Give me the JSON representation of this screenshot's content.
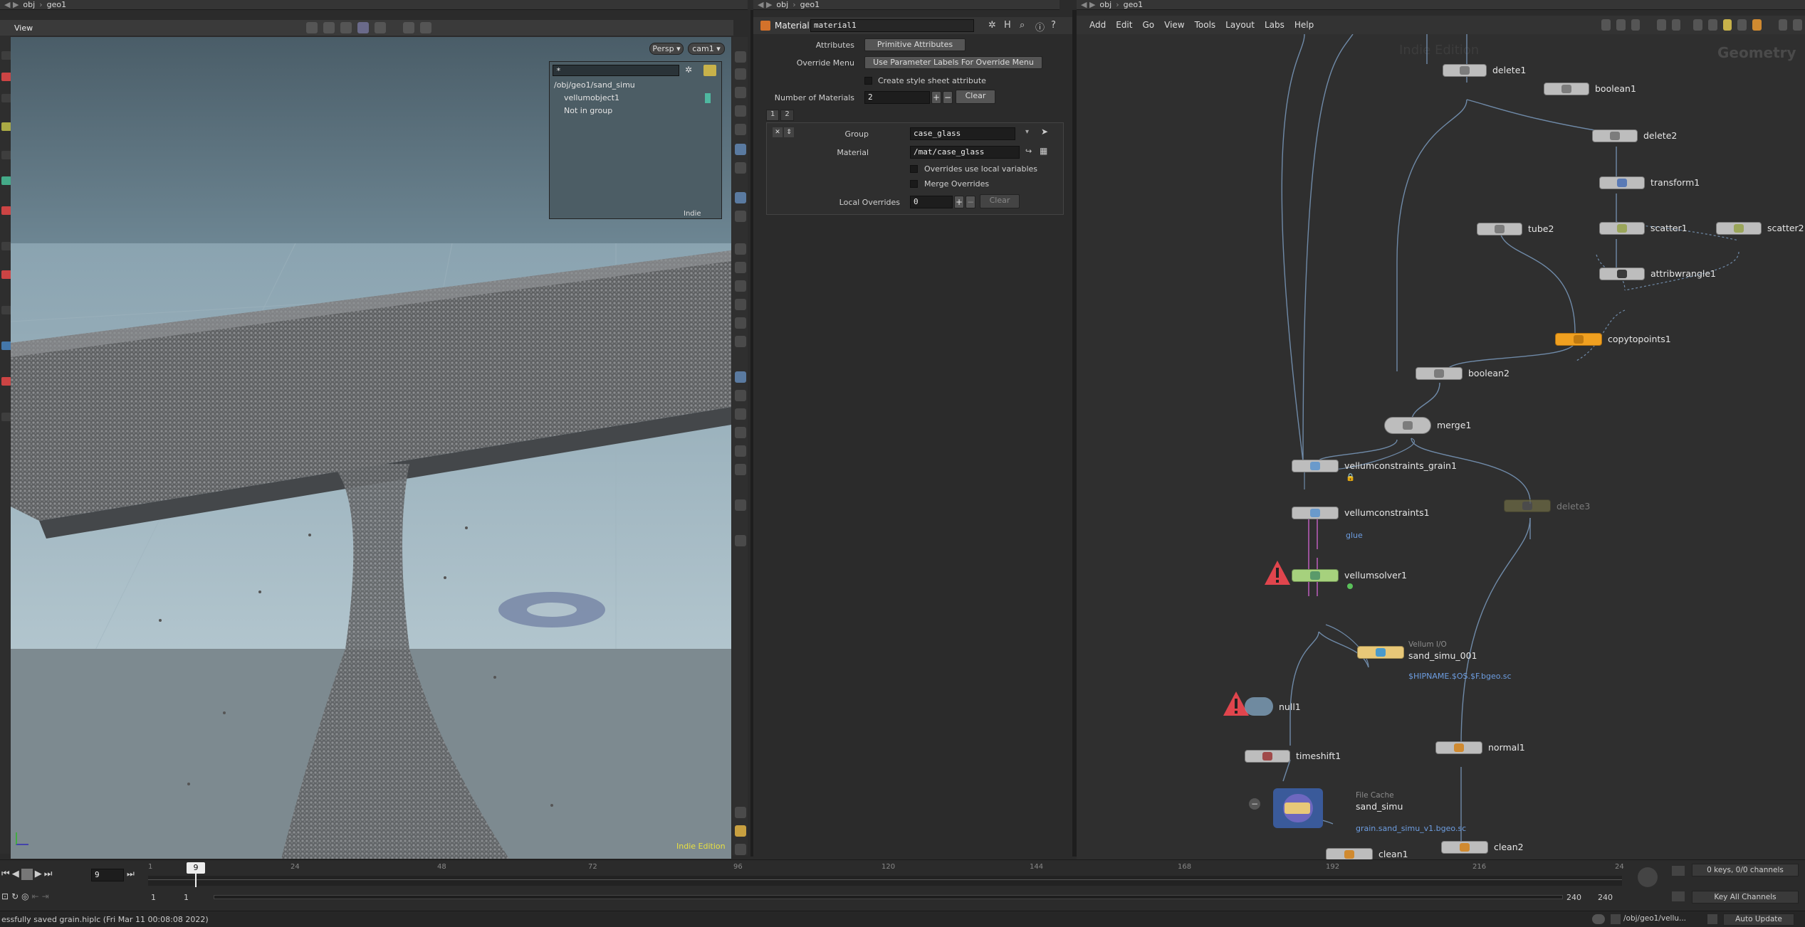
{
  "left_pane": {
    "path": [
      "obj",
      "geo1"
    ],
    "view_label": "View",
    "camera_menu": "Persp ▾",
    "cam_menu": "cam1 ▾",
    "tree_filter": "*",
    "tree_items": [
      "/obj/geo1/sand_simu",
      "vellumobject1",
      "Not in group"
    ],
    "tree_footer": "Indie",
    "watermark": "Indie Edition"
  },
  "param_pane": {
    "path": [
      "obj",
      "geo1"
    ],
    "node_type": "Material",
    "node_name": "material1",
    "attributes_label": "Attributes",
    "attributes_value": "Primitive Attributes",
    "override_menu_label": "Override Menu",
    "override_menu_value": "Use Parameter Labels For Override Menu",
    "style_sheet_label": "Create style sheet attribute",
    "num_materials_label": "Number of Materials",
    "num_materials_value": "2",
    "clear_label": "Clear",
    "tabs": [
      "1",
      "2"
    ],
    "group_label": "Group",
    "group_value": "case_glass",
    "material_label": "Material",
    "material_value": "/mat/case_glass",
    "overrides_local_label": "Overrides use local variables",
    "merge_overrides_label": "Merge Overrides",
    "local_overrides_label": "Local Overrides",
    "local_overrides_value": "0",
    "local_clear_label": "Clear"
  },
  "network_pane": {
    "path": [
      "obj",
      "geo1"
    ],
    "menu": [
      "Add",
      "Edit",
      "Go",
      "View",
      "Tools",
      "Layout",
      "Labs",
      "Help"
    ],
    "watermark": "Indie Edition",
    "context_label": "Geometry",
    "nodes": {
      "delete1": "delete1",
      "boolean1": "boolean1",
      "delete2": "delete2",
      "transform1": "transform1",
      "tube2": "tube2",
      "scatter1": "scatter1",
      "scatter2": "scatter2",
      "attribwrangle1": "attribwrangle1",
      "copytopoints1": "copytopoints1",
      "boolean2": "boolean2",
      "merge1": "merge1",
      "vellumconstraints_grain1": "vellumconstraints_grain1",
      "vellumconstraints1": "vellumconstraints1",
      "glue": "glue",
      "delete3": "delete3",
      "vellumsolver1": "vellumsolver1",
      "vellum_io_caption": "Vellum I/O",
      "sand_simu_001": "sand_simu_001",
      "sand_simu_001_file": "$HIPNAME.$OS.$F.bgeo.sc",
      "null1": "null1",
      "timeshift1": "timeshift1",
      "normal1": "normal1",
      "file_cache_caption": "File Cache",
      "sand_simu": "sand_simu",
      "sand_simu_file": "grain.sand_simu_v1.bgeo.sc",
      "clean1": "clean1",
      "clean2": "clean2"
    }
  },
  "timeline": {
    "current_frame": "9",
    "frame_marker": "9",
    "ticks": [
      "1",
      "24",
      "48",
      "72",
      "96",
      "120",
      "144",
      "168",
      "192",
      "216",
      "24"
    ],
    "range_start": "1",
    "range_start2": "1",
    "range_end": "240",
    "range_end2": "240",
    "keys_label": "0 keys, 0/0 channels",
    "key_channels": "Key All Channels"
  },
  "status": {
    "message": "essfully saved grain.hiplc (Fri Mar 11 00:08:08 2022)",
    "path": "/obj/geo1/vellu...",
    "update": "Auto Update"
  },
  "colors": {
    "accent_orange": "#f0a020",
    "node_green": "#a6d17d",
    "node_yellow": "#e8c878",
    "warning_red": "#e0454d",
    "link_blue": "#6d9de0"
  }
}
